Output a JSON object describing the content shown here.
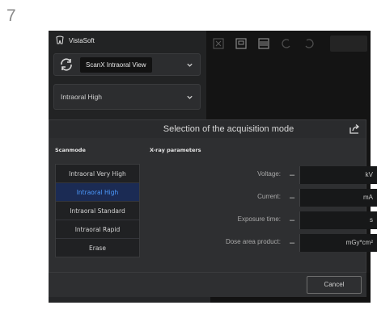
{
  "step": "7",
  "app": {
    "brand": "VistaSoft",
    "device": "ScanX Intraoral View",
    "mode": "Intraoral High"
  },
  "toolbar": {
    "icons": [
      "crop-icon",
      "frame-icon",
      "barcode-icon",
      "undo-icon",
      "redo-icon"
    ]
  },
  "dialog": {
    "title": "Selection of the acquisition mode",
    "scanmode_header": "Scanmode",
    "xray_header": "X-ray parameters",
    "scanmodes": [
      {
        "label": "Intraoral Very High",
        "selected": false
      },
      {
        "label": "Intraoral High",
        "selected": true
      },
      {
        "label": "Intraoral Standard",
        "selected": false
      },
      {
        "label": "Intraoral Rapid",
        "selected": false
      },
      {
        "label": "Erase",
        "selected": false
      }
    ],
    "params": [
      {
        "label": "Voltage:",
        "unit": "kV"
      },
      {
        "label": "Current:",
        "unit": "mA"
      },
      {
        "label": "Exposure time:",
        "unit": "s"
      },
      {
        "label": "Dose area product:",
        "unit": "mGy*cm²"
      }
    ],
    "minus": "–",
    "plus": "+",
    "cancel": "Cancel"
  },
  "colors": {
    "selected_bg": "#1b2b54",
    "selected_text": "#4c9bff",
    "panel": "#2e2f31"
  }
}
